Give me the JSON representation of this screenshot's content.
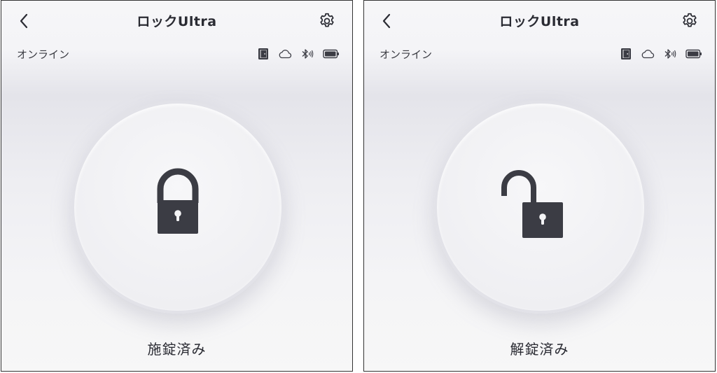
{
  "screens": [
    {
      "header": {
        "title": "ロックUltra"
      },
      "status": {
        "connection": "オンライン"
      },
      "lock": {
        "state_label": "施錠済み",
        "icon": "lock-closed-icon"
      }
    },
    {
      "header": {
        "title": "ロックUltra"
      },
      "status": {
        "connection": "オンライン"
      },
      "lock": {
        "state_label": "解錠済み",
        "icon": "lock-open-icon"
      }
    }
  ],
  "icons": {
    "back": "chevron-left-icon",
    "settings": "gear-icon",
    "door": "door-icon",
    "cloud": "cloud-icon",
    "bluetooth": "bluetooth-icon",
    "battery": "battery-icon"
  },
  "colors": {
    "text": "#2a2b33",
    "lock_body": "#3b3c44",
    "panel_border": "#333333"
  }
}
